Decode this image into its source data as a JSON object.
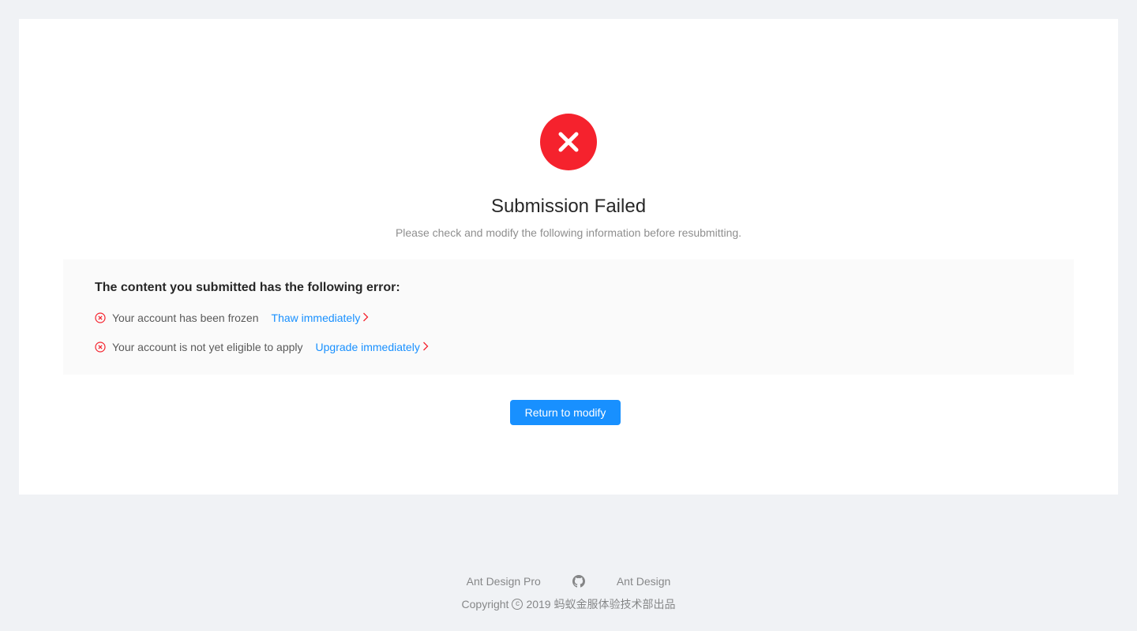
{
  "result": {
    "status_icon": "close-circle-icon",
    "status_color": "#f5222d",
    "title": "Submission Failed",
    "subtitle": "Please check and modify the following information before resubmitting."
  },
  "errors": {
    "heading": "The content you submitted has the following error:",
    "items": [
      {
        "text": "Your account has been frozen",
        "link_label": "Thaw immediately"
      },
      {
        "text": "Your account is not yet eligible to apply",
        "link_label": "Upgrade immediately"
      }
    ]
  },
  "actions": {
    "return_label": "Return to modify"
  },
  "footer": {
    "links": [
      "Ant Design Pro",
      "Ant Design"
    ],
    "github_icon": "github-icon",
    "copyright_prefix": "Copyright",
    "copyright_symbol": "c",
    "copyright_suffix": "2019 蚂蚁金服体验技术部出品"
  },
  "colors": {
    "primary": "#1890ff",
    "error": "#f5222d",
    "page_bg": "#f0f2f5"
  }
}
